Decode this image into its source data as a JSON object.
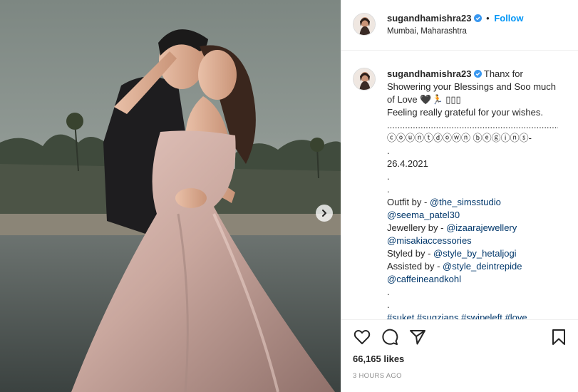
{
  "post": {
    "username": "sugandhamishra23",
    "follow_label": "Follow",
    "separator": "•",
    "location": "Mumbai, Maharashtra"
  },
  "caption": {
    "username": "sugandhamishra23",
    "line1": " Thanx for Showering your Blessings and Soo much of Love 🖤🏃 ▯▯▯",
    "line2": "Feeling really grateful for your wishes.",
    "dots": ".........................................................................",
    "countdown": "ⓒⓞⓤⓝⓣⓓⓞⓦⓝ ⓑⓔⓖⓘⓝⓢ-",
    "dot_a": ".",
    "date": "26.4.2021",
    "dot_b": ".",
    "dot_c": ".",
    "outfit_label": "Outfit by - ",
    "outfit_tag1": "@the_simsstudio",
    "outfit_tag2": "@seema_patel30",
    "jewellery_label": "Jewellery by - ",
    "jewellery_tag1": "@izaarajewellery",
    "jewellery_tag2": "@misakiaccessories",
    "styled_label": "Styled by - ",
    "styled_tag": "@style_by_hetaljogi",
    "assisted_label": "Assisted by - ",
    "assisted_tag1": "@style_deintrepide",
    "assisted_tag2": "@caffeineandkohl",
    "dot_d": ".",
    "dot_e": ".",
    "hashtags": "#suket #sugzians #swipeleft #love"
  },
  "stats": {
    "likes": "66,165 likes",
    "time": "3 HOURS AGO"
  },
  "icons": {
    "like": "heart-icon",
    "comment": "comment-icon",
    "share": "send-icon",
    "save": "bookmark-icon",
    "next": "chevron-right-icon",
    "verified": "verified-badge-icon"
  },
  "colors": {
    "link": "#0095f6",
    "tag": "#00376b",
    "muted": "#8e8e8e",
    "text": "#262626"
  }
}
